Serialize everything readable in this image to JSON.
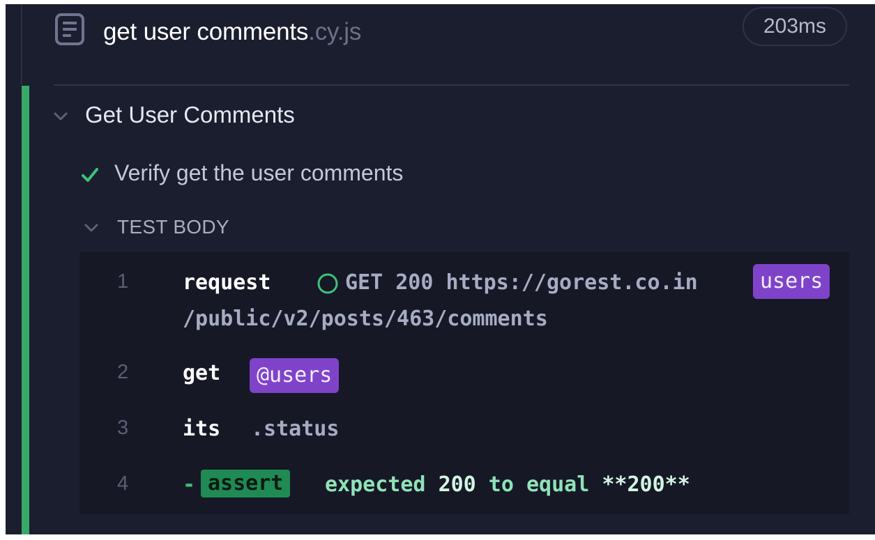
{
  "spec": {
    "file_name": "get user comments",
    "file_ext": ".cy.js",
    "duration": "203ms"
  },
  "suite": {
    "title": "Get User Comments"
  },
  "test": {
    "title": "Verify get the user comments",
    "state": "passed"
  },
  "test_body": {
    "label": "TEST BODY",
    "commands": [
      {
        "number": "1",
        "name": "request",
        "message_line1": "GET 200 https://gorest.co.in",
        "alias": "users",
        "message_line2": "/public/v2/posts/463/comments"
      },
      {
        "number": "2",
        "name": "get",
        "alias": "@users"
      },
      {
        "number": "3",
        "name": "its",
        "message": ".status"
      },
      {
        "number": "4",
        "dash": "-",
        "name": "assert",
        "message_prefix": "expected ",
        "expected_value": "200",
        "message_mid": " to equal ",
        "actual_value": "**200**"
      }
    ]
  },
  "colors": {
    "pass": "#3aa866",
    "alias": "#7f43c9",
    "assert": "#1f8a54",
    "background": "#1b1e2e"
  }
}
